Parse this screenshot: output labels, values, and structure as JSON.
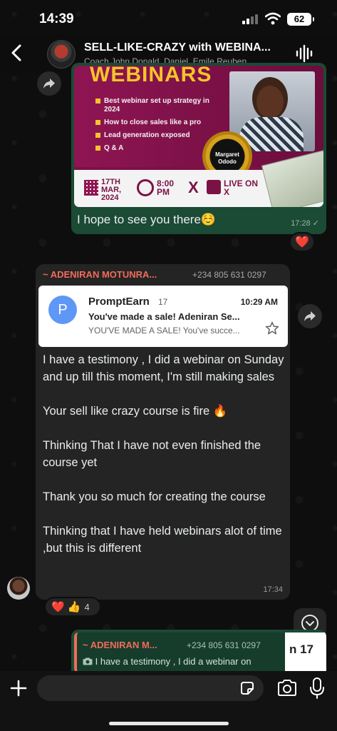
{
  "status_bar": {
    "time": "14:39",
    "battery": "62"
  },
  "header": {
    "title": "SELL-LIKE-CRAZY with WEBINA...",
    "subtitle": "Coach John Donald, Daniel, Emile Reuben,..."
  },
  "flyer": {
    "heading": "WEBINARS",
    "bullets": [
      "Best webinar set up strategy in 2024",
      "How to close sales like a pro",
      "Lead generation exposed",
      "Q & A"
    ],
    "host_seal": "Margaret Ododo",
    "date": "17TH MAR, 2024",
    "time": "8:00 PM",
    "x_letter": "X",
    "live": "LIVE ON X"
  },
  "outgoing": {
    "text": "I hope to see you there☺️",
    "time": "17:28",
    "reaction": "❤️"
  },
  "incoming": {
    "sender": "~ ADENIRAN MOTUNRA...",
    "phone": "+234 805 631 0297",
    "email": {
      "avatar_letter": "P",
      "from": "PromptEarn",
      "count": "17",
      "time": "10:29 AM",
      "subject": "You've made a sale! Adeniran Se...",
      "snippet": "YOU'VE MADE A SALE! You've succe..."
    },
    "paragraphs": [
      "I have a testimony , I did a webinar on Sunday and up till this moment, I'm still making sales",
      "Your sell like crazy course is fire 🔥",
      "Thinking That I have not even finished the course yet",
      "Thank you so much for creating the course",
      "Thinking that I have held webinars alot of time ,but this is different"
    ],
    "time": "17:34",
    "reactions": {
      "emojis": "❤️ 👍",
      "count": "4"
    }
  },
  "reply": {
    "sender": "~ ADENIRAN M...",
    "phone": "+234 805 631 0297",
    "text": "I have a testimony , I did a webinar on",
    "thumb_text": "n 17"
  },
  "colors": {
    "outgoing_bubble": "#1b4a35",
    "incoming_bubble": "#242424",
    "sender_name": "#f26b5b",
    "accent_flyer": "#7b1246"
  },
  "icons": [
    "back-arrow-icon",
    "voice-chat-icon",
    "forward-icon",
    "star-icon",
    "chevron-down-icon",
    "plus-icon",
    "sticker-icon",
    "camera-icon",
    "microphone-icon"
  ]
}
